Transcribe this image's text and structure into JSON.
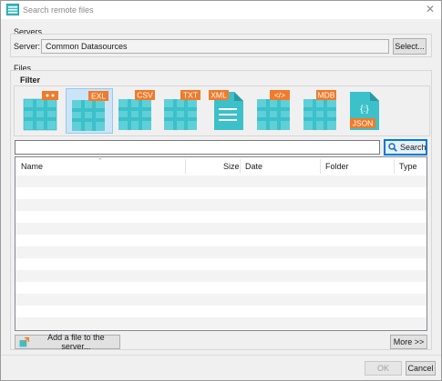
{
  "window": {
    "title": "Search remote files",
    "close_glyph": "✕"
  },
  "servers": {
    "group_label": "Servers",
    "server_label": "Server:",
    "server_value": "Common Datasources",
    "select_label": "Select..."
  },
  "files": {
    "group_label": "Files",
    "filter_label": "Filter",
    "filters": [
      {
        "name": "all-files-icon",
        "badge": ""
      },
      {
        "name": "excel-icon",
        "badge": "EXL",
        "selected": true
      },
      {
        "name": "csv-icon",
        "badge": "CSV"
      },
      {
        "name": "txt-icon",
        "badge": "TXT"
      },
      {
        "name": "xml-icon",
        "badge": "XML"
      },
      {
        "name": "html-icon",
        "badge": "</>"
      },
      {
        "name": "mdb-icon",
        "badge": "MDB"
      },
      {
        "name": "json-icon",
        "badge": "JSON"
      }
    ],
    "search_value": "",
    "search_label": "Search",
    "columns": [
      "Name",
      "Size",
      "Date",
      "Folder",
      "Type"
    ],
    "add_file_label": "Add a file to the server...",
    "more_label": "More >>"
  },
  "footer": {
    "ok_label": "OK",
    "cancel_label": "Cancel"
  },
  "colors": {
    "teal": "#3cc0c9",
    "orange": "#f07b2b",
    "accent": "#0078d7"
  }
}
